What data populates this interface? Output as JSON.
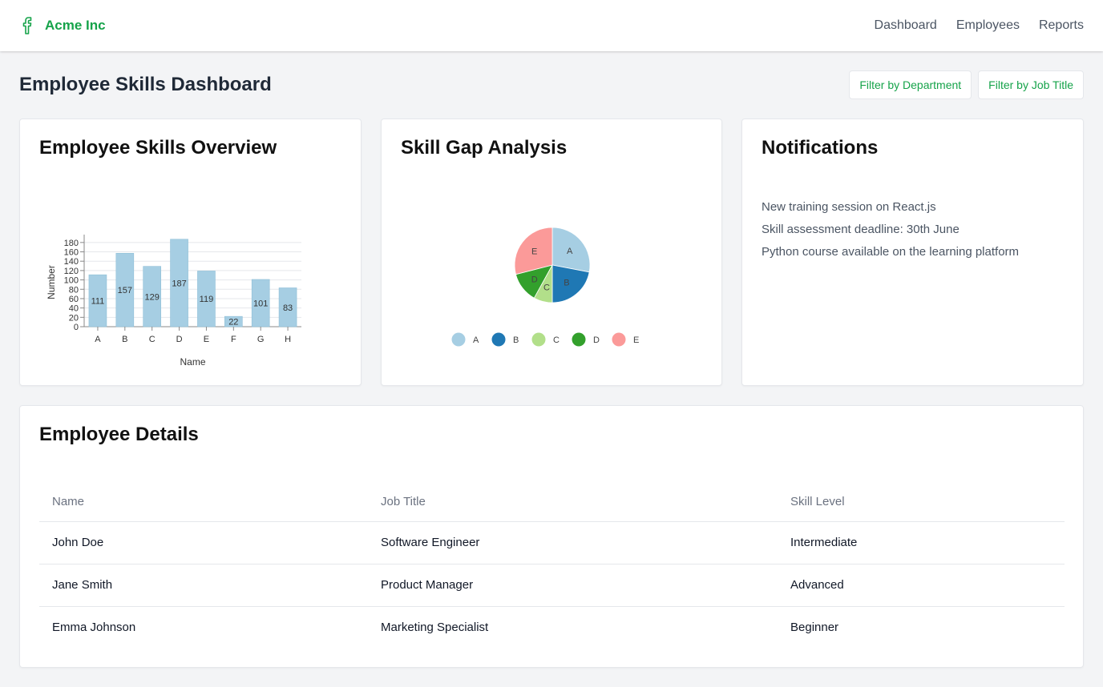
{
  "brand": {
    "name": "Acme Inc",
    "logo_icon": "facebook-f-icon"
  },
  "nav": [
    "Dashboard",
    "Employees",
    "Reports"
  ],
  "page": {
    "title": "Employee Skills Dashboard"
  },
  "filters": {
    "department": "Filter by Department",
    "job_title": "Filter by Job Title"
  },
  "cards": {
    "skills_overview": "Employee Skills Overview",
    "skill_gap": "Skill Gap Analysis",
    "notifications": "Notifications",
    "employee_details": "Employee Details"
  },
  "notifications": [
    "New training session on React.js",
    "Skill assessment deadline: 30th June",
    "Python course available on the learning platform"
  ],
  "table": {
    "headers": [
      "Name",
      "Job Title",
      "Skill Level"
    ],
    "rows": [
      [
        "John Doe",
        "Software Engineer",
        "Intermediate"
      ],
      [
        "Jane Smith",
        "Product Manager",
        "Advanced"
      ],
      [
        "Emma Johnson",
        "Marketing Specialist",
        "Beginner"
      ]
    ]
  },
  "colors": {
    "brand": "#16a34a",
    "bar": "#a6cee3"
  },
  "chart_data": [
    {
      "type": "bar",
      "categories": [
        "A",
        "B",
        "C",
        "D",
        "E",
        "F",
        "G",
        "H"
      ],
      "values": [
        111,
        157,
        129,
        187,
        119,
        22,
        101,
        83
      ],
      "xlabel": "Name",
      "ylabel": "Number",
      "yticks": [
        0,
        20,
        40,
        60,
        80,
        100,
        120,
        140,
        160,
        180
      ],
      "ylim": [
        0,
        190
      ],
      "grid": true,
      "color": "#a6cee3"
    },
    {
      "type": "pie",
      "categories": [
        "A",
        "B",
        "C",
        "D",
        "E"
      ],
      "values": [
        28,
        22,
        8,
        13,
        29
      ],
      "colors": [
        "#a6cee3",
        "#1f78b4",
        "#b2df8a",
        "#33a02c",
        "#fb9a99"
      ],
      "legend": "bottom"
    }
  ]
}
